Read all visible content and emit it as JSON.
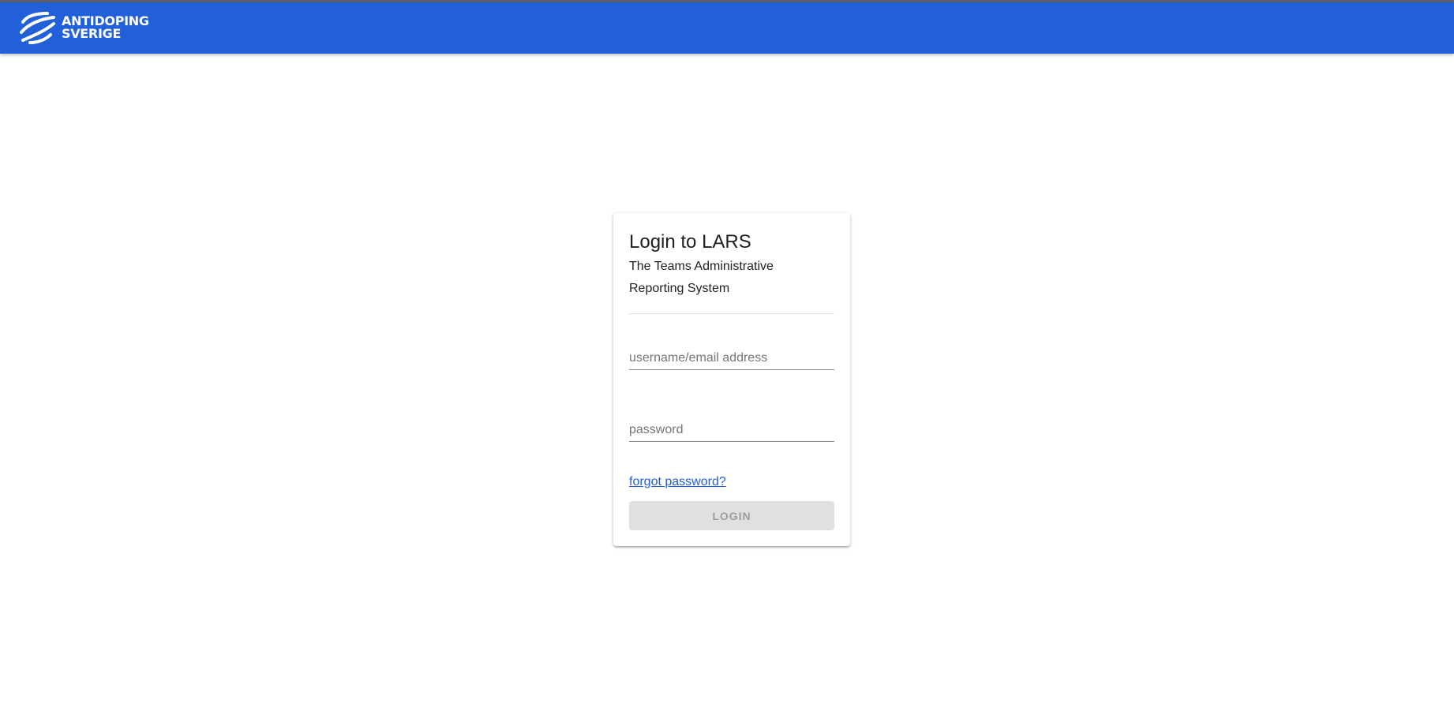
{
  "header": {
    "brand_line1": "ANTIDOPING",
    "brand_line2": "SVERIGE",
    "brand_icon": "antidoping-logo-icon",
    "background": "#2160d9"
  },
  "login_card": {
    "title": "Login to LARS",
    "subtitle": "The Teams Administrative Reporting System",
    "username_placeholder": "username/email address",
    "username_value": "",
    "password_placeholder": "password",
    "password_value": "",
    "forgot_link": "forgot password?",
    "login_button": "LOGIN",
    "login_disabled": true
  },
  "colors": {
    "accent": "#2160d9",
    "button_disabled_bg": "#e0e0e0",
    "button_disabled_text": "#9e9e9e"
  }
}
